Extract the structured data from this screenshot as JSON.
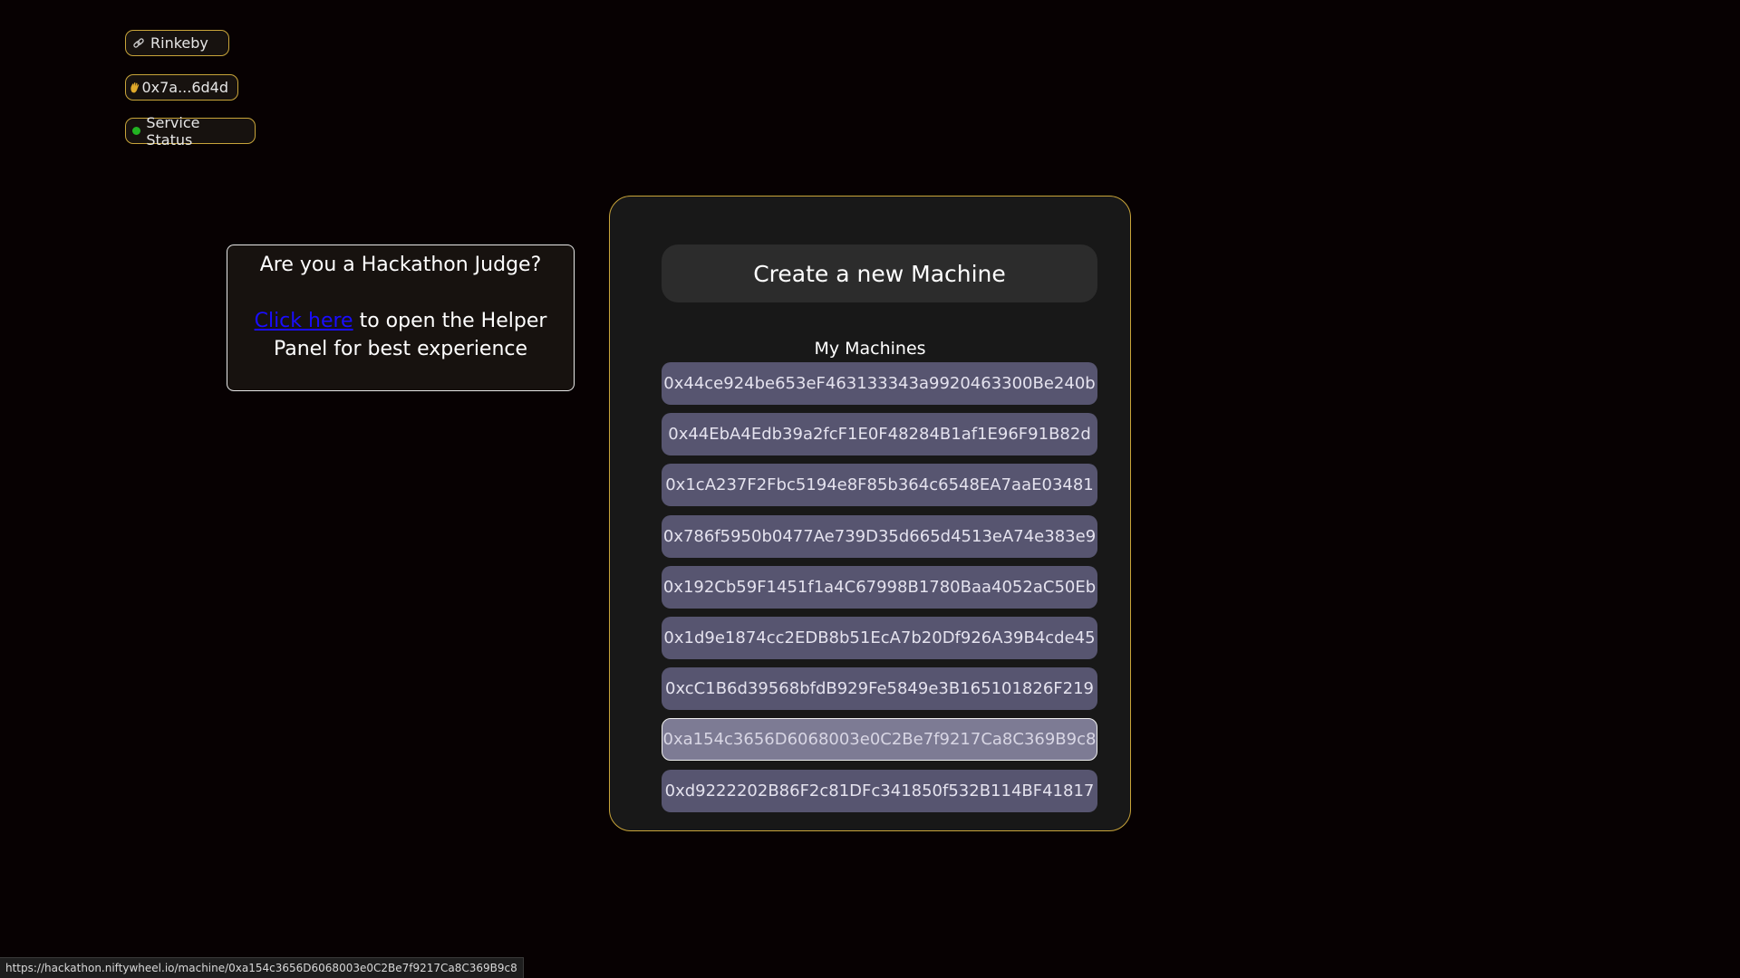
{
  "header": {
    "network_label": "Rinkeby",
    "wallet_label": "0x7a...6d4d",
    "status_label": "Service Status",
    "status_color": "#22b422",
    "accent_color": "#c8a43a"
  },
  "judge_panel": {
    "title": "Are you a Hackathon Judge?",
    "link_text": "Click here",
    "body_text": " to open the Helper Panel for best experience"
  },
  "main": {
    "create_button_label": "Create a new Machine",
    "machines_title": "My Machines",
    "machines": [
      "0x44ce924be653eF463133343a9920463300Be240b",
      "0x44EbA4Edb39a2fcF1E0F48284B1af1E96F91B82d",
      "0x1cA237F2Fbc5194e8F85b364c6548EA7aaE03481",
      "0x786f5950b0477Ae739D35d665d4513eA74e383e9",
      "0x192Cb59F1451f1a4C67998B1780Baa4052aC50Eb",
      "0x1d9e1874cc2EDB8b51EcA7b20Df926A39B4cde45",
      "0xcC1B6d39568bfdB929Fe5849e3B165101826F219",
      "0xa154c3656D6068003e0C2Be7f9217Ca8C369B9c8",
      "0xd9222202B86F2c81DFc341850f532B114BF41817"
    ],
    "hovered_index": 7
  },
  "status_bar": {
    "url": "https://hackathon.niftywheel.io/machine/0xa154c3656D6068003e0C2Be7f9217Ca8C369B9c8"
  }
}
